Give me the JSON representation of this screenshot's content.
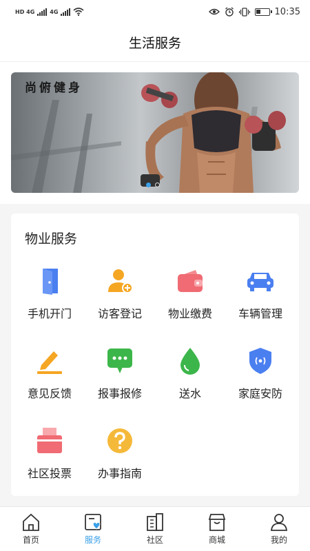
{
  "status_bar": {
    "net_left": "HD 4G",
    "net_right": "4G",
    "time": "10:35"
  },
  "header": {
    "title": "生活服务"
  },
  "banner": {
    "logo_text": "尚俯健身",
    "slides": 2,
    "active_slide": 1
  },
  "property_services": {
    "title": "物业服务",
    "items": [
      {
        "label": "手机开门",
        "icon": "door-icon",
        "color": "#4a7ff0"
      },
      {
        "label": "访客登记",
        "icon": "add-visitor-icon",
        "color": "#f5a623"
      },
      {
        "label": "物业缴费",
        "icon": "wallet-icon",
        "color": "#f06b73"
      },
      {
        "label": "车辆管理",
        "icon": "car-icon",
        "color": "#4a7ff0"
      },
      {
        "label": "意见反馈",
        "icon": "pencil-icon",
        "color": "#f5a623"
      },
      {
        "label": "报事报修",
        "icon": "chat-bubble-icon",
        "color": "#3cb64a"
      },
      {
        "label": "送水",
        "icon": "water-drop-icon",
        "color": "#3cb64a"
      },
      {
        "label": "家庭安防",
        "icon": "shield-icon",
        "color": "#4a7ff0"
      },
      {
        "label": "社区投票",
        "icon": "ballot-box-icon",
        "color": "#f06b73"
      },
      {
        "label": "办事指南",
        "icon": "question-icon",
        "color": "#f5b93a"
      }
    ]
  },
  "tab_bar": {
    "active": "服务",
    "accent_color": "#3aa0e8",
    "tabs": [
      {
        "label": "首页",
        "icon": "home-icon"
      },
      {
        "label": "服务",
        "icon": "service-icon"
      },
      {
        "label": "社区",
        "icon": "community-icon"
      },
      {
        "label": "商城",
        "icon": "store-icon"
      },
      {
        "label": "我的",
        "icon": "profile-icon"
      }
    ]
  }
}
